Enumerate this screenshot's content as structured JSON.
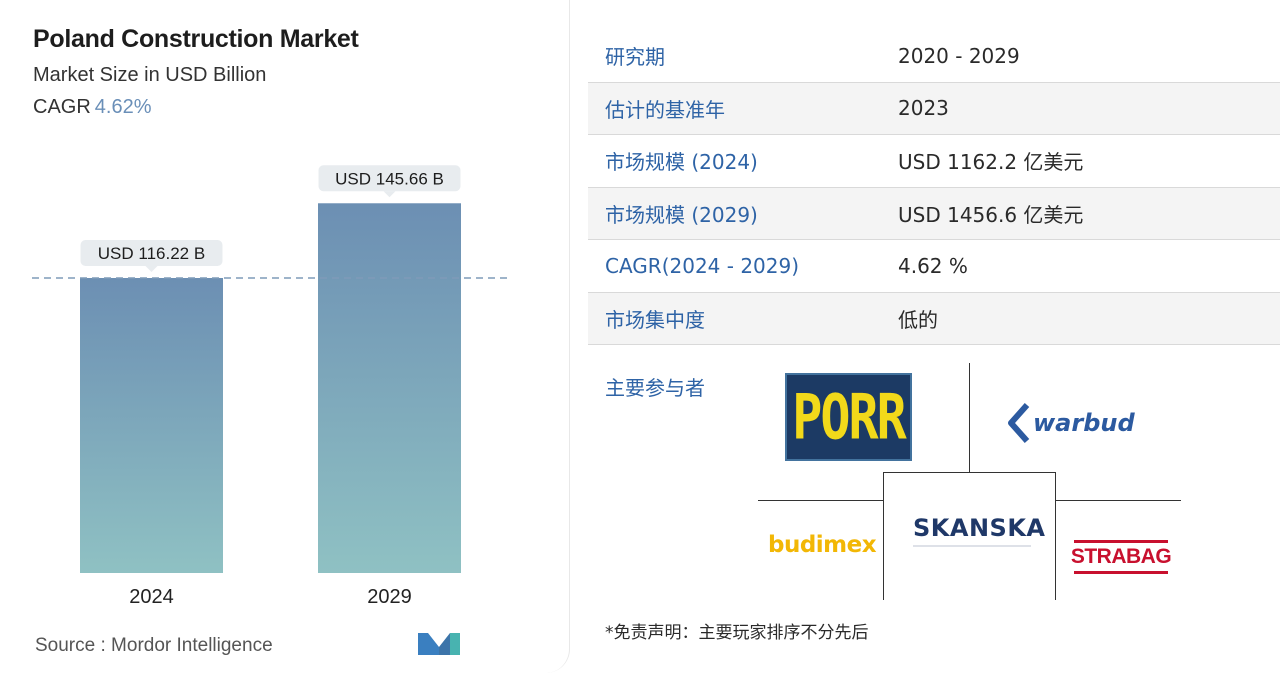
{
  "header": {
    "title": "Poland Construction Market",
    "subtitle": "Market Size in USD Billion",
    "cagr_label": "CAGR",
    "cagr_value": "4.62%"
  },
  "chart_data": {
    "type": "bar",
    "categories": [
      "2024",
      "2029"
    ],
    "values": [
      116.22,
      145.66
    ],
    "data_labels": [
      "USD 116.22 B",
      "USD 145.66 B"
    ],
    "ylim": [
      0,
      160
    ],
    "reference_line": "dashed line at 2024 value",
    "bar_gradient": [
      "#6c8fb3",
      "#8fc1c3"
    ]
  },
  "source": {
    "label": "Source :",
    "name": "Mordor Intelligence"
  },
  "table": {
    "rows": [
      {
        "key": "研究期",
        "value": "2020 - 2029"
      },
      {
        "key": "估计的基准年",
        "value": "2023"
      },
      {
        "key": "市场规模 (2024)",
        "value": "USD 1162.2 亿美元"
      },
      {
        "key": "市场规模 (2029)",
        "value": "USD 1456.6 亿美元"
      },
      {
        "key": "CAGR(2024 - 2029)",
        "value": "4.62 %"
      },
      {
        "key": "市场集中度",
        "value": "低的"
      }
    ]
  },
  "players": {
    "label": "主要参与者",
    "logos": [
      "PORR",
      "warbud",
      "budimex",
      "SKANSKA",
      "STRABAG"
    ],
    "disclaimer": "*免责声明：主要玩家排序不分先后"
  },
  "colors": {
    "accent_blue": "#2e63a6",
    "cagr_value": "#6a8fb8"
  }
}
